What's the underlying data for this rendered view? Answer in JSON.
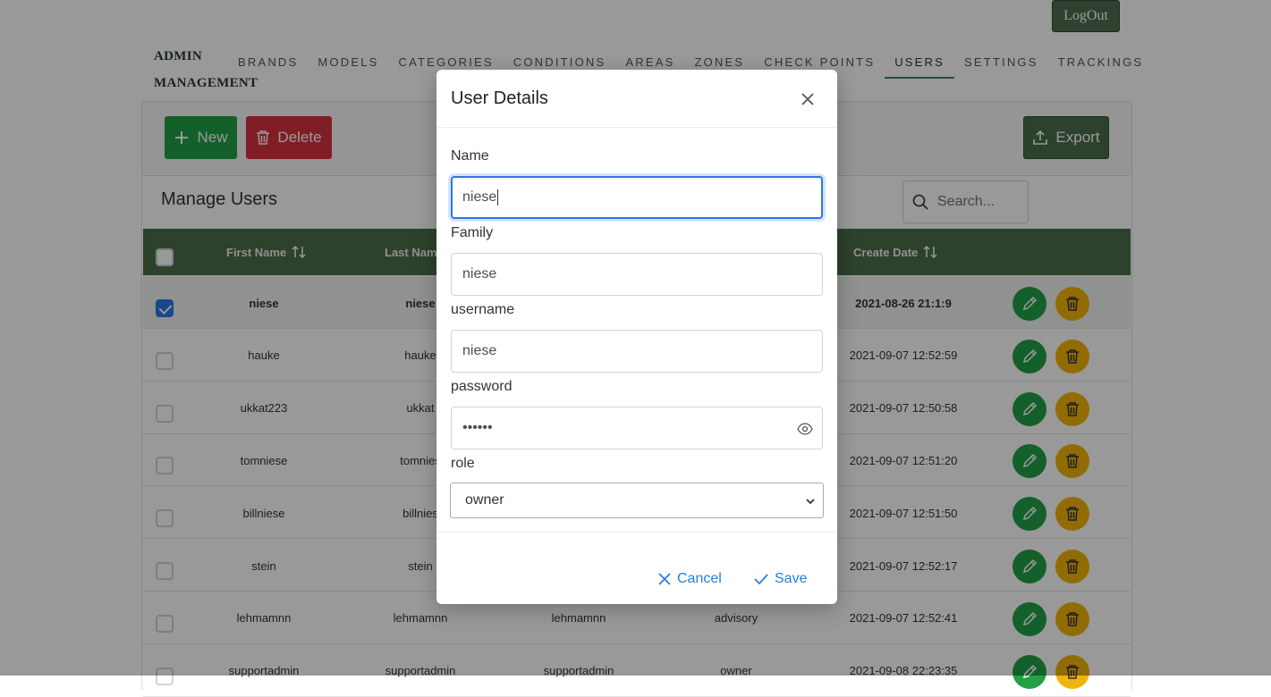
{
  "header": {
    "logout_label": "LogOut",
    "brand_line1": "ADMIN",
    "brand_line2": "MANAGEMENT",
    "nav": [
      "BRANDS",
      "MODELS",
      "CATEGORIES",
      "CONDITIONS",
      "AREAS",
      "ZONES",
      "CHECK POINTS",
      "USERS",
      "SETTINGS",
      "TRACKINGS"
    ],
    "active_nav": "USERS"
  },
  "toolbar": {
    "new_label": "New",
    "delete_label": "Delete",
    "export_label": "Export"
  },
  "panel": {
    "title": "Manage Users",
    "search_placeholder": "Search..."
  },
  "table": {
    "headers": {
      "first_name": "First Name",
      "last_name": "Last Name",
      "create_date": "Create Date"
    },
    "rows": [
      {
        "first": "niese",
        "last": "niese",
        "username": "",
        "role": "",
        "date": "2021-08-26 21:1:9",
        "selected": true
      },
      {
        "first": "hauke",
        "last": "hauke",
        "username": "",
        "role": "",
        "date": "2021-09-07 12:52:59",
        "selected": false
      },
      {
        "first": "ukkat223",
        "last": "ukkat",
        "username": "",
        "role": "",
        "date": "2021-09-07 12:50:58",
        "selected": false
      },
      {
        "first": "tomniese",
        "last": "tomnies",
        "username": "",
        "role": "",
        "date": "2021-09-07 12:51:20",
        "selected": false
      },
      {
        "first": "billniese",
        "last": "billnies",
        "username": "",
        "role": "",
        "date": "2021-09-07 12:51:50",
        "selected": false
      },
      {
        "first": "stein",
        "last": "stein",
        "username": "",
        "role": "",
        "date": "2021-09-07 12:52:17",
        "selected": false
      },
      {
        "first": "lehmamnn",
        "last": "lehmamnn",
        "username": "lehmamnn",
        "role": "advisory",
        "date": "2021-09-07 12:52:41",
        "selected": false
      },
      {
        "first": "supportadmin",
        "last": "supportadmin",
        "username": "supportadmin",
        "role": "owner",
        "date": "2021-09-08 22:23:35",
        "selected": false
      }
    ]
  },
  "modal": {
    "title": "User Details",
    "name_label": "Name",
    "name_value": "niese",
    "family_label": "Family",
    "family_value": "niese",
    "username_label": "username",
    "username_value": "niese",
    "password_label": "password",
    "password_value": "••••••",
    "role_label": "role",
    "role_value": "owner",
    "cancel_label": "Cancel",
    "save_label": "Save"
  },
  "colors": {
    "green": "#22a146",
    "red": "#d7333f",
    "dark_green": "#4a6e4a",
    "yellow": "#f2b409",
    "link_blue": "#2b7fd4"
  }
}
